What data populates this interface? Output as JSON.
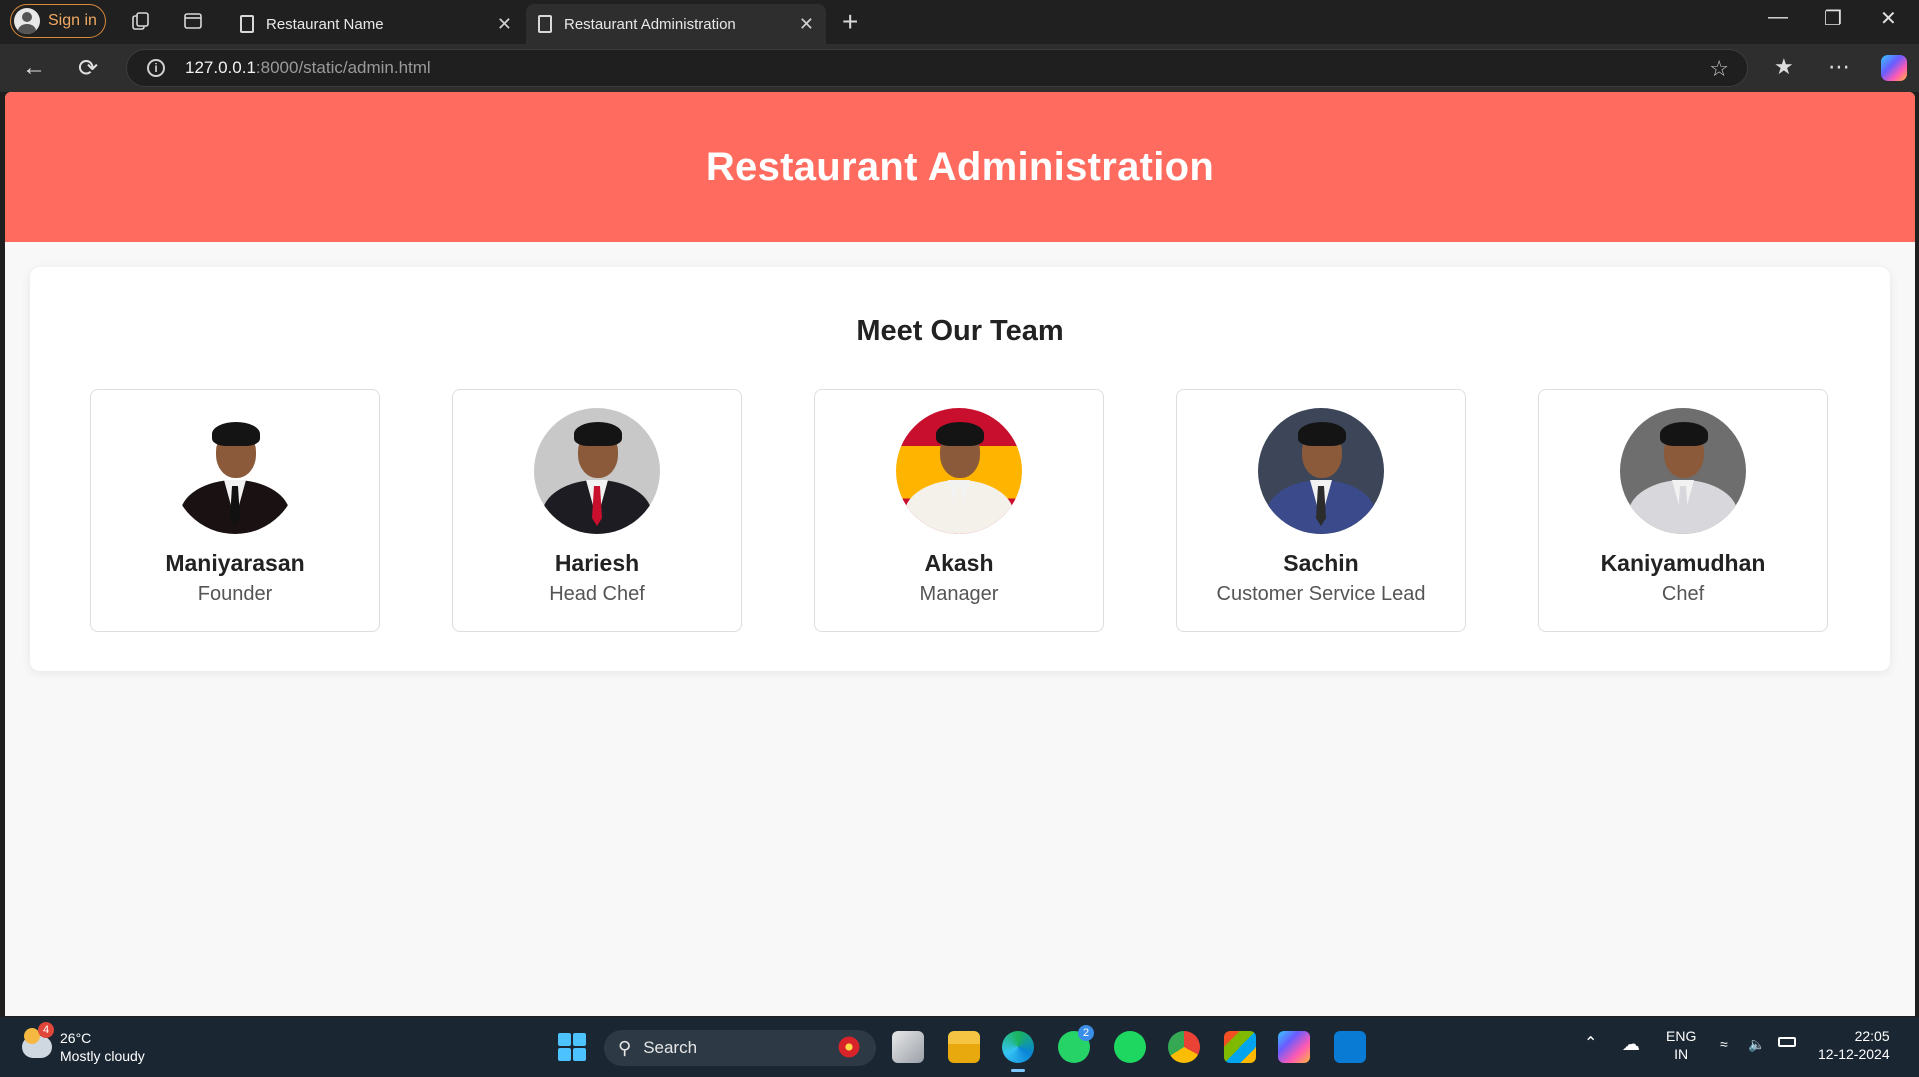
{
  "browser": {
    "signin_label": "Sign in",
    "tabs": [
      {
        "title": "Restaurant Name",
        "close": "✕"
      },
      {
        "title": "Restaurant Administration",
        "close": "✕"
      }
    ],
    "new_tab": "+",
    "window_controls": {
      "minimize": "—",
      "restore": "❐",
      "close": "✕"
    },
    "url_host": "127.0.0.1",
    "url_path": ":8000/static/admin.html",
    "info_icon": "i"
  },
  "page": {
    "header_title": "Restaurant Administration",
    "section_title": "Meet Our Team",
    "accent_color": "#ff6b5e",
    "team": [
      {
        "name": "Maniyarasan",
        "role": "Founder",
        "bg": "#ffffff",
        "suit": "#1a1212",
        "tie": "#111111"
      },
      {
        "name": "Hariesh",
        "role": "Head Chef",
        "bg": "#c8c8c8",
        "suit": "#1c1c22",
        "tie": "#c8102e"
      },
      {
        "name": "Akash",
        "role": "Manager",
        "bg": "#ffb400",
        "suit": "#f4f1ea",
        "tie": "#f4f1ea"
      },
      {
        "name": "Sachin",
        "role": "Customer Service Lead",
        "bg": "#3c4658",
        "suit": "#3a4a8a",
        "tie": "#2c2c2c"
      },
      {
        "name": "Kaniyamudhan",
        "role": "Chef",
        "bg": "#6e6e6e",
        "suit": "#d8d8dc",
        "tie": "#d8d8dc"
      }
    ]
  },
  "taskbar": {
    "weather_temp": "26°C",
    "weather_desc": "Mostly cloudy",
    "weather_badge": "4",
    "search_label": "Search",
    "whatsapp_badge": "2",
    "lang_top": "ENG",
    "lang_bottom": "IN",
    "time": "22:05",
    "date": "12-12-2024"
  }
}
